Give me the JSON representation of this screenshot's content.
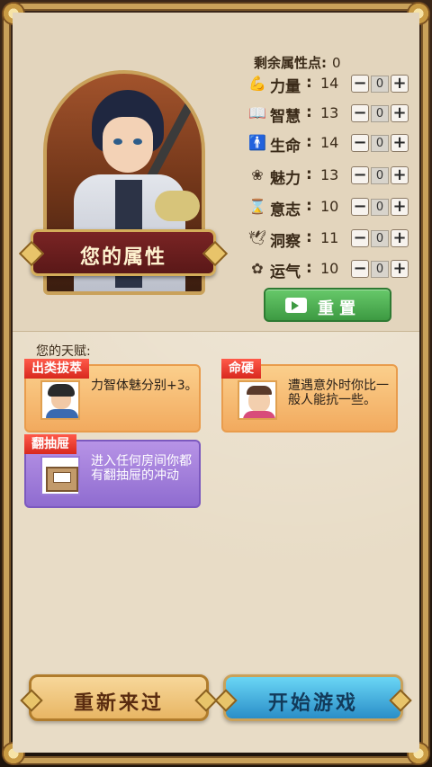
{
  "portrait": {
    "title": "您的属性"
  },
  "attributes_header": {
    "label": "剩余属性点:",
    "value": "0"
  },
  "attributes": [
    {
      "name": "力量",
      "icon": "arm-strength-icon",
      "glyph": "💪",
      "value": "14",
      "alloc": "0"
    },
    {
      "name": "智慧",
      "icon": "book-wisdom-icon",
      "glyph": "📖",
      "value": "13",
      "alloc": "0"
    },
    {
      "name": "生命",
      "icon": "person-life-icon",
      "glyph": "🚹",
      "value": "14",
      "alloc": "0"
    },
    {
      "name": "魅力",
      "icon": "flower-charm-icon",
      "glyph": "❀",
      "value": "13",
      "alloc": "0"
    },
    {
      "name": "意志",
      "icon": "hourglass-will-icon",
      "glyph": "⌛",
      "value": "10",
      "alloc": "0"
    },
    {
      "name": "洞察",
      "icon": "bird-insight-icon",
      "glyph": "🕊",
      "value": "11",
      "alloc": "0"
    },
    {
      "name": "运气",
      "icon": "clover-luck-icon",
      "glyph": "✿",
      "value": "10",
      "alloc": "0"
    }
  ],
  "controls": {
    "minus": "−",
    "plus": "+",
    "colon": ":"
  },
  "reset_button": {
    "label": "重置"
  },
  "talents": {
    "heading": "您的天赋:",
    "items": [
      {
        "tag": "出类拔萃",
        "desc": "力智体魅分别+3。",
        "color": "orange"
      },
      {
        "tag": "命硬",
        "desc": "遭遇意外时你比一般人能抗一些。",
        "color": "orange"
      },
      {
        "tag": "翻抽屉",
        "desc": "进入任何房间你都有翻抽屉的冲动",
        "color": "purple"
      }
    ]
  },
  "bottom": {
    "restart": "重新来过",
    "start": "开始游戏"
  },
  "colors": {
    "accent_gold": "#c9a15a",
    "reset_green": "#3d9a42",
    "tag_red": "#d8281e",
    "start_blue": "#2a8ec8"
  }
}
